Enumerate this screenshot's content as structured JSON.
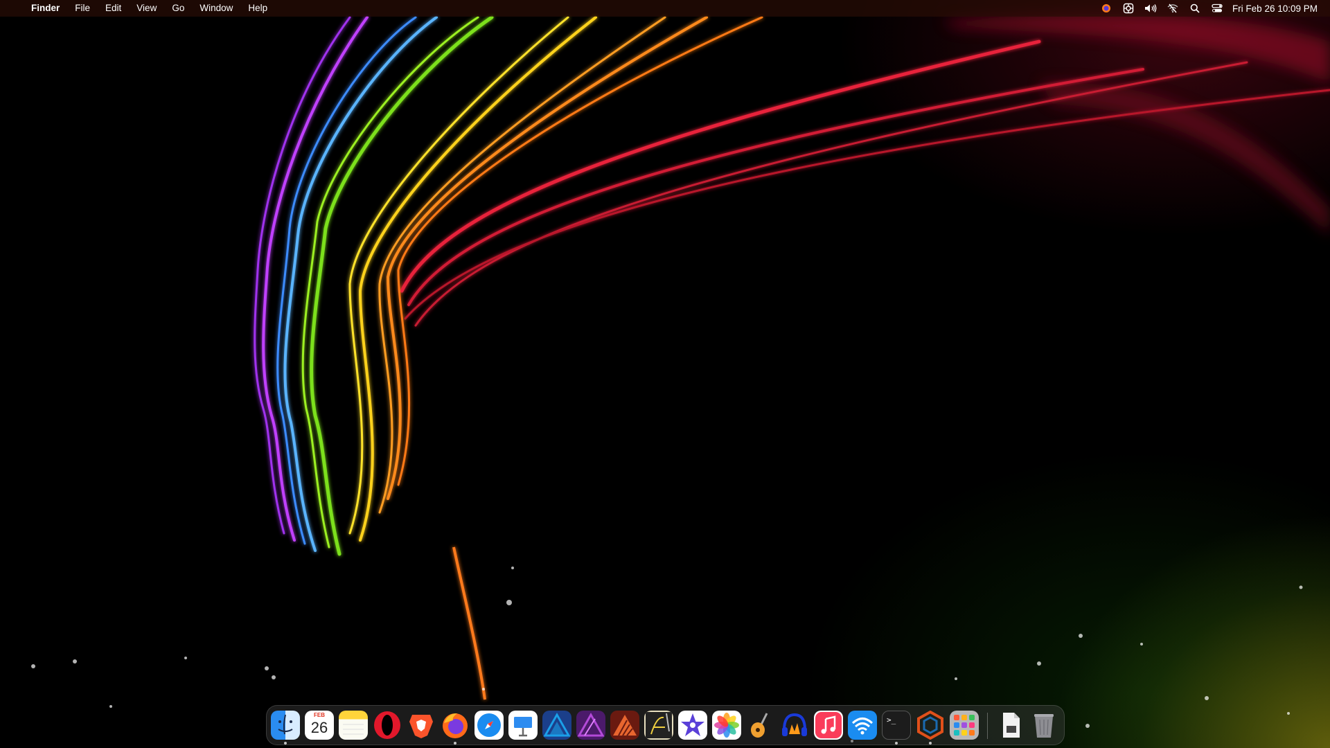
{
  "menubar": {
    "apple_icon": "apple-logo-icon",
    "app_name": "Finder",
    "menus": [
      "File",
      "Edit",
      "View",
      "Go",
      "Window",
      "Help"
    ],
    "status_icons": [
      "firefox-extension-icon",
      "screenshot-tool-icon",
      "volume-icon",
      "wifi-off-icon",
      "search-icon",
      "control-center-icon"
    ],
    "clock": "Fri Feb 26  10:09 PM"
  },
  "dock": {
    "apps": [
      {
        "name": "finder",
        "icon": "finder-icon",
        "running": true
      },
      {
        "name": "calendar",
        "icon": "calendar-icon",
        "running": false
      },
      {
        "name": "notes",
        "icon": "notes-icon",
        "running": false
      },
      {
        "name": "opera",
        "icon": "opera-icon",
        "running": false
      },
      {
        "name": "brave",
        "icon": "brave-icon",
        "running": false
      },
      {
        "name": "firefox",
        "icon": "firefox-icon",
        "running": true
      },
      {
        "name": "safari",
        "icon": "safari-icon",
        "running": false
      },
      {
        "name": "keynote",
        "icon": "keynote-icon",
        "running": false
      },
      {
        "name": "affinity-designer",
        "icon": "affinity-designer-icon",
        "running": false
      },
      {
        "name": "affinity-photo",
        "icon": "affinity-photo-icon",
        "running": false
      },
      {
        "name": "affinity-publisher",
        "icon": "affinity-publisher-icon",
        "running": false
      },
      {
        "name": "script-editor",
        "icon": "script-icon",
        "running": false
      },
      {
        "name": "imovie",
        "icon": "imovie-icon",
        "running": false
      },
      {
        "name": "photos",
        "icon": "photos-icon",
        "running": false
      },
      {
        "name": "garageband",
        "icon": "garageband-icon",
        "running": false
      },
      {
        "name": "audio-app",
        "icon": "headphones-icon",
        "running": false
      },
      {
        "name": "music",
        "icon": "music-icon",
        "running": false
      },
      {
        "name": "wifi-utility",
        "icon": "wifi-icon",
        "running": false
      },
      {
        "name": "terminal",
        "icon": "terminal-icon",
        "running": true
      },
      {
        "name": "hex-app",
        "icon": "hexagon-icon",
        "running": true
      },
      {
        "name": "launchpad",
        "icon": "launchpad-icon",
        "running": false
      }
    ],
    "calendar": {
      "month": "FEB",
      "day": "26"
    },
    "terminal_prompt": ">_",
    "extras": [
      "document-icon",
      "trash-icon"
    ]
  },
  "colors": {
    "menubar_bg": "#2a0c06",
    "opera_red": "#e2182b",
    "brave_orange": "#fb542b",
    "affinity_blue": "#1b9fe8",
    "affinity_purple": "#b34ad8",
    "affinity_orange": "#e8662f"
  }
}
